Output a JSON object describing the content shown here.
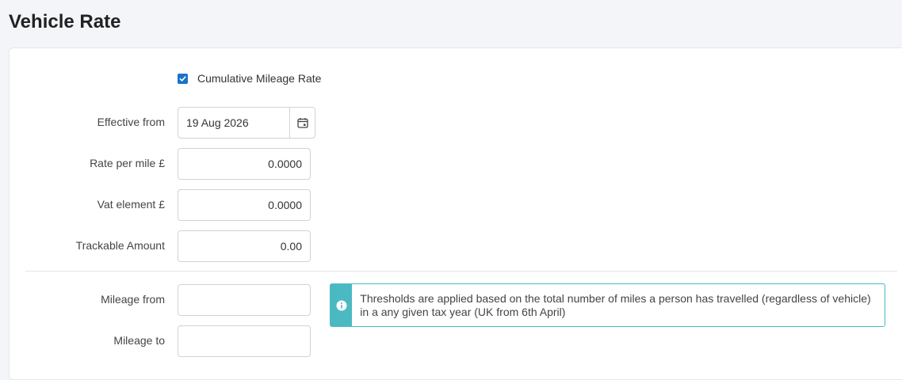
{
  "page": {
    "title": "Vehicle Rate"
  },
  "form": {
    "cumulative": {
      "label": "Cumulative Mileage Rate",
      "checked": true
    },
    "effective_from": {
      "label": "Effective from",
      "value": "19 Aug 2026"
    },
    "rate_per_mile": {
      "label": "Rate per mile £",
      "value": "0.0000"
    },
    "vat_element": {
      "label": "Vat element £",
      "value": "0.0000"
    },
    "trackable_amount": {
      "label": "Trackable Amount",
      "value": "0.00"
    },
    "mileage_from": {
      "label": "Mileage from",
      "value": ""
    },
    "mileage_to": {
      "label": "Mileage to",
      "value": ""
    }
  },
  "info": {
    "text": "Thresholds are applied based on the total number of miles a person has travelled (regardless of vehicle) in a any given tax year (UK from 6th April)",
    "icon": "info-circle-icon"
  },
  "colors": {
    "accent": "#1a73c9",
    "info": "#4bb9c1"
  }
}
